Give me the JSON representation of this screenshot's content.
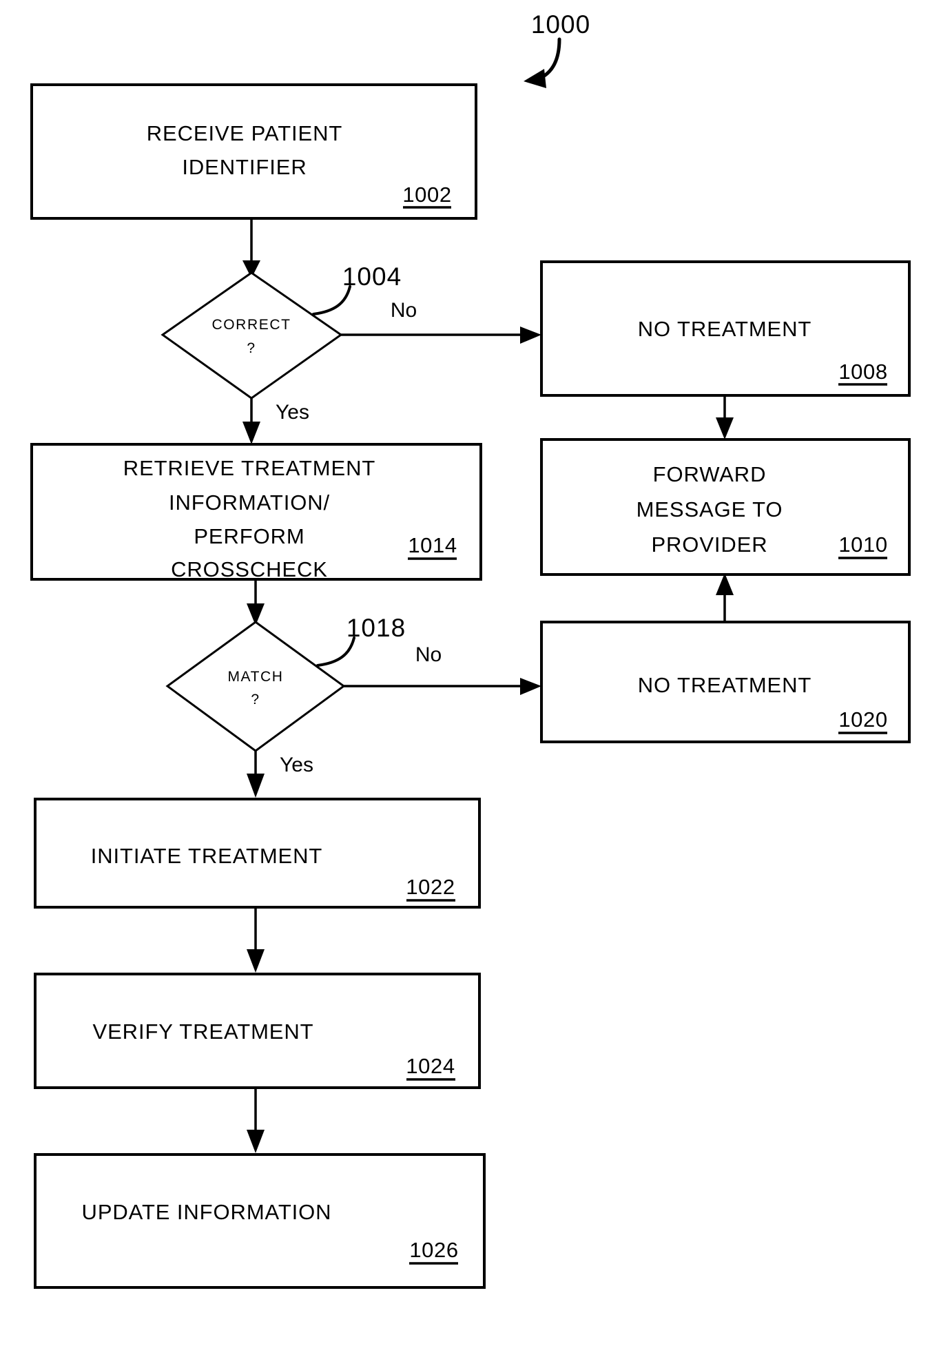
{
  "figure": {
    "number": "1000",
    "type": "process-flowchart",
    "title_visible": false
  },
  "nodes": [
    {
      "id": "n1002",
      "shape": "rect",
      "ref": "1002",
      "lines": [
        "RECEIVE PATIENT",
        "IDENTIFIER"
      ]
    },
    {
      "id": "n1004",
      "shape": "diamond",
      "ref": "1004",
      "lines": [
        "CORRECT",
        "?"
      ]
    },
    {
      "id": "n1008",
      "shape": "rect",
      "ref": "1008",
      "lines": [
        "NO TREATMENT"
      ]
    },
    {
      "id": "n1010",
      "shape": "rect",
      "ref": "1010",
      "lines": [
        "FORWARD",
        "MESSAGE TO",
        "PROVIDER"
      ]
    },
    {
      "id": "n1014",
      "shape": "rect",
      "ref": "1014",
      "lines": [
        "RETRIEVE TREATMENT",
        "INFORMATION/",
        "PERFORM",
        "CROSSCHECK"
      ]
    },
    {
      "id": "n1018",
      "shape": "diamond",
      "ref": "1018",
      "lines": [
        "MATCH",
        "?"
      ]
    },
    {
      "id": "n1020",
      "shape": "rect",
      "ref": "1020",
      "lines": [
        "NO TREATMENT"
      ]
    },
    {
      "id": "n1022",
      "shape": "rect",
      "ref": "1022",
      "lines": [
        "INITIATE TREATMENT"
      ]
    },
    {
      "id": "n1024",
      "shape": "rect",
      "ref": "1024",
      "lines": [
        "VERIFY TREATMENT"
      ]
    },
    {
      "id": "n1026",
      "shape": "rect",
      "ref": "1026",
      "lines": [
        "UPDATE INFORMATION"
      ]
    }
  ],
  "branch_labels": {
    "correct_no": "No",
    "correct_yes": "Yes",
    "match_no": "No",
    "match_yes": "Yes"
  },
  "edges": [
    {
      "from": "n1002",
      "to": "n1004",
      "label": ""
    },
    {
      "from": "n1004",
      "to": "n1008",
      "label": "No"
    },
    {
      "from": "n1004",
      "to": "n1014",
      "label": "Yes"
    },
    {
      "from": "n1008",
      "to": "n1010",
      "label": ""
    },
    {
      "from": "n1014",
      "to": "n1018",
      "label": ""
    },
    {
      "from": "n1018",
      "to": "n1020",
      "label": "No"
    },
    {
      "from": "n1018",
      "to": "n1022",
      "label": "Yes"
    },
    {
      "from": "n1020",
      "to": "n1010",
      "label": ""
    },
    {
      "from": "n1022",
      "to": "n1024",
      "label": ""
    },
    {
      "from": "n1024",
      "to": "n1026",
      "label": ""
    }
  ],
  "colors": {
    "ink": "#000000",
    "paper": "#ffffff"
  }
}
